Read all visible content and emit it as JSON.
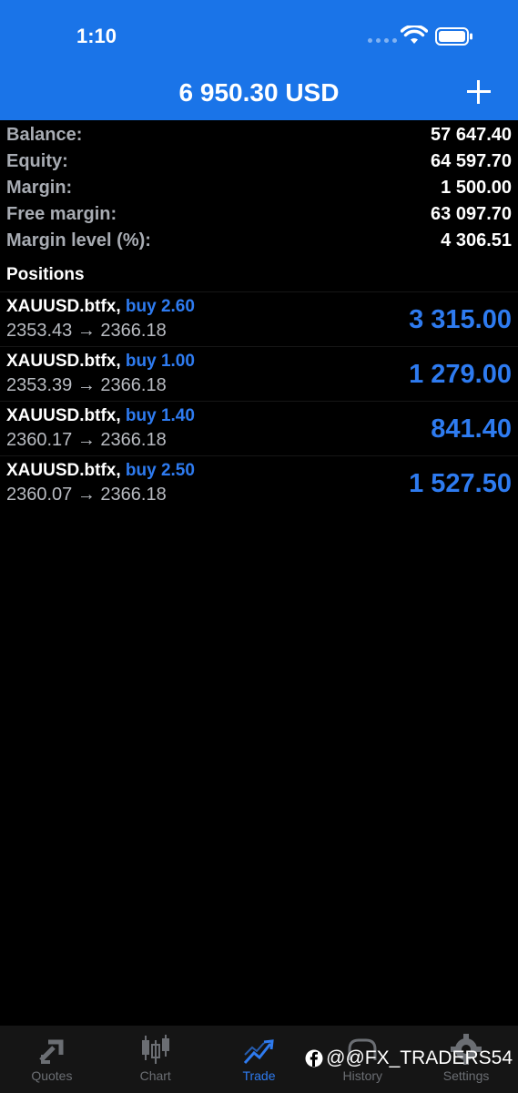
{
  "status_bar": {
    "time": "1:10"
  },
  "header": {
    "title": "6 950.30 USD"
  },
  "summary": [
    {
      "label": "Balance:",
      "value": "57 647.40"
    },
    {
      "label": "Equity:",
      "value": "64 597.70"
    },
    {
      "label": "Margin:",
      "value": "1 500.00"
    },
    {
      "label": "Free margin:",
      "value": "63 097.70"
    },
    {
      "label": "Margin level (%):",
      "value": "4 306.51"
    }
  ],
  "positions_header": "Positions",
  "positions": [
    {
      "symbol": "XAUUSD.btfx,",
      "side": "buy 2.60",
      "prices": "2353.43 → 2366.18",
      "profit": "3 315.00"
    },
    {
      "symbol": "XAUUSD.btfx,",
      "side": "buy 1.00",
      "prices": "2353.39 → 2366.18",
      "profit": "1 279.00"
    },
    {
      "symbol": "XAUUSD.btfx,",
      "side": "buy 1.40",
      "prices": "2360.17 → 2366.18",
      "profit": "841.40"
    },
    {
      "symbol": "XAUUSD.btfx,",
      "side": "buy 2.50",
      "prices": "2360.07 → 2366.18",
      "profit": "1 527.50"
    }
  ],
  "tabs": [
    {
      "label": "Quotes",
      "icon": "quotes-arrows-icon"
    },
    {
      "label": "Chart",
      "icon": "candlestick-icon"
    },
    {
      "label": "Trade",
      "icon": "trend-chart-icon"
    },
    {
      "label": "History",
      "icon": "history-icon"
    },
    {
      "label": "Settings",
      "icon": "gear-icon"
    }
  ],
  "active_tab": "Trade",
  "watermark": "@@FX_TRADERS54",
  "colors": {
    "header_blue": "#1a74e8",
    "accent_blue": "#2e7bf0",
    "background": "#000000",
    "label_gray": "#a8acb3",
    "tab_bar": "#151515"
  }
}
